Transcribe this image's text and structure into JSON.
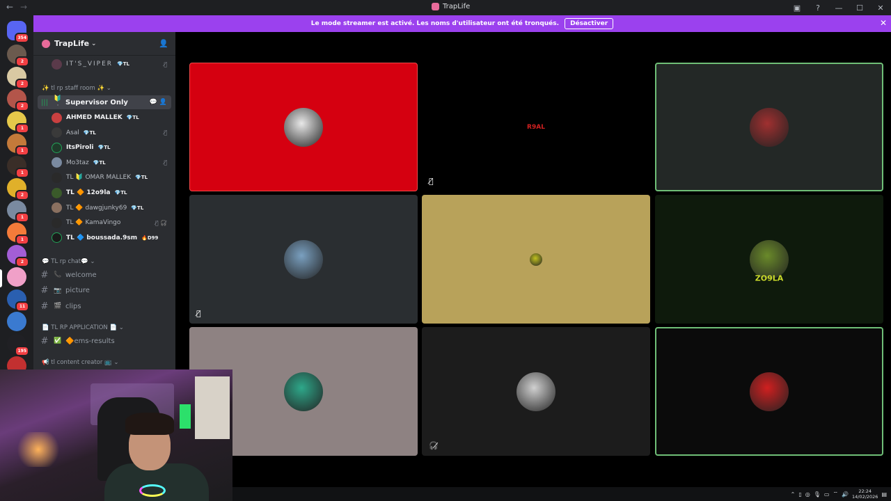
{
  "window": {
    "title": "TrapLife",
    "back": "←",
    "forward": "→",
    "controls": [
      "▣",
      "?",
      "—",
      "☐",
      "✕"
    ]
  },
  "banner": {
    "text": "Le mode streamer est activé. Les noms d'utilisateur ont été tronqués.",
    "button": "Désactiver",
    "close": "✕"
  },
  "rail": {
    "home_badge": "354",
    "servers": [
      {
        "badge": "2",
        "color": "#6b5a4e"
      },
      {
        "badge": "2",
        "color": "#d9c9a3"
      },
      {
        "badge": "2",
        "color": "#b3554a"
      },
      {
        "badge": "1",
        "color": "#e5c84a"
      },
      {
        "badge": "1",
        "color": "#c47a3a"
      },
      {
        "badge": "1",
        "color": "#3a2e28"
      },
      {
        "badge": "2",
        "color": "#e0b02a"
      },
      {
        "badge": "1",
        "color": "#7a8aa0"
      },
      {
        "badge": "1",
        "color": "#f47b3a"
      },
      {
        "badge": "2",
        "color": "#a35ed6"
      },
      {
        "badge": "",
        "color": "#f0a0c8"
      },
      {
        "badge": "11",
        "color": "#2a5fb0"
      },
      {
        "badge": "",
        "color": "#3a7ad0"
      },
      {
        "badge": "195",
        "color": "#202024"
      },
      {
        "badge": "",
        "color": "#c23030"
      }
    ]
  },
  "sidebar": {
    "guild_name": "TrapLife",
    "top_user": {
      "name": "IT'S_VIPER",
      "tag": "💎TL"
    },
    "voice_category": "✨ tl rp staff room ✨",
    "voice_channel": "Supervisor Only",
    "voice_users": [
      {
        "name": "AHMED MALLEK",
        "tag": "💎TL",
        "bright": true,
        "color": "#c94040",
        "status": ""
      },
      {
        "name": "Asal",
        "tag": "💎TL",
        "bright": false,
        "color": "#3a3a3a",
        "status": "🎙̸"
      },
      {
        "name": "ItsPiroli",
        "tag": "💎TL",
        "bright": true,
        "color": "#1f3a2a",
        "status": ""
      },
      {
        "name": "Mo3taz",
        "tag": "💎TL",
        "bright": false,
        "color": "#7a8aa0",
        "status": "🎙̸"
      },
      {
        "name": "TL 🔰 OMAR MALLEK",
        "tag": "💎TL",
        "bright": false,
        "color": "#2a2a2a",
        "status": ""
      },
      {
        "name": "TL 🔶 12o9la",
        "tag": "💎TL",
        "bright": true,
        "color": "#3a5a2a",
        "status": ""
      },
      {
        "name": "TL 🔶 dawgjunky69",
        "tag": "💎TL",
        "bright": false,
        "color": "#8a7060",
        "status": ""
      },
      {
        "name": "TL 🔶 KamaVingo",
        "tag": "",
        "bright": false,
        "color": "#2a2a2a",
        "status": "🎙̸ 🎧̸"
      },
      {
        "name": "TL 🔷 boussada.9sm",
        "tag": "🔥D99",
        "bright": true,
        "color": "#1a1a1a",
        "status": ""
      }
    ],
    "categories": [
      {
        "name": "💬 TL rp chat💬",
        "channels": [
          {
            "icon": "📞",
            "name": "welcome"
          },
          {
            "icon": "📷",
            "name": "picture"
          },
          {
            "icon": "🎬",
            "name": "clips"
          }
        ]
      },
      {
        "name": "📄 TL RP APPLICATION 📄",
        "channels": [
          {
            "icon": "✅",
            "name": "🔶ems-results"
          }
        ]
      },
      {
        "name": "📢 tl content creator 📺",
        "channels": []
      }
    ]
  },
  "tiles": [
    {
      "bg": "#d50010",
      "avatar_color": "#e8e8e8",
      "speaking": false,
      "muted": false
    },
    {
      "bg": "#000000",
      "avatar_color": "#c01818",
      "speaking": false,
      "muted": true,
      "label": "R9AL"
    },
    {
      "bg": "#232826",
      "avatar_color": "#a03030",
      "speaking": true,
      "muted": false
    },
    {
      "bg": "#2a2e31",
      "avatar_color": "#7aa0c0",
      "speaking": false,
      "muted": true
    },
    {
      "bg": "#b8a25a",
      "avatar_color": "#c0c020",
      "speaking": false,
      "muted": false
    },
    {
      "bg": "#0e1a0c",
      "avatar_color": "#6a8a2a",
      "speaking": false,
      "muted": false,
      "label": "ZO9LA"
    },
    {
      "bg": "#8e8282",
      "avatar_color": "#2ea88a",
      "speaking": false,
      "muted": false
    },
    {
      "bg": "#1c1c1c",
      "avatar_color": "#d0d0d0",
      "speaking": false,
      "muted": false,
      "deafened": true
    },
    {
      "bg": "#0b0b0b",
      "avatar_color": "#d02020",
      "speaking": true,
      "muted": false
    }
  ],
  "tray": {
    "time": "22:24",
    "date": "14/02/2026"
  }
}
